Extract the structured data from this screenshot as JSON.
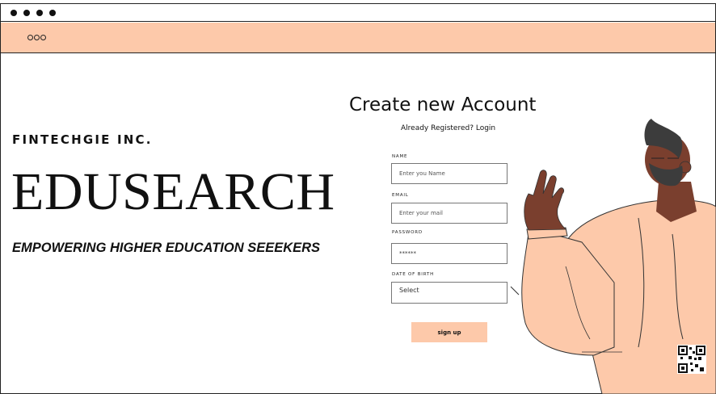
{
  "window": {
    "title_dots": 4,
    "menu_icon": "more-horizontal-icon"
  },
  "hero": {
    "company": "FINTECHGIE INC.",
    "brand": "EDUSEARCH",
    "tagline": "EMPOWERING HIGHER EDUCATION SEEEKERS"
  },
  "form": {
    "title": "Create new Account",
    "subtitle": "Already Registered? Login",
    "name": {
      "label": "NAME",
      "placeholder": "Enter you Name"
    },
    "email": {
      "label": "EMAIL",
      "placeholder": "Enter your mail"
    },
    "password": {
      "label": "PASSWORD",
      "value": "******"
    },
    "dob": {
      "label": "DATE OF BIRTH",
      "value": "Select"
    },
    "submit_label": "sign up"
  },
  "colors": {
    "accent": "#fdc9aa",
    "skin": "#7a3f2e",
    "hair": "#3c3c3c"
  },
  "icons": {
    "qr": "qr-code-icon"
  }
}
